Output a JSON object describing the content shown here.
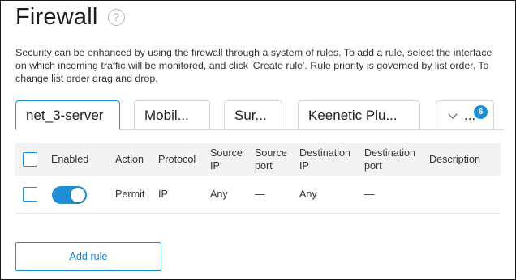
{
  "page": {
    "title": "Firewall",
    "help_icon": "?",
    "description": "Security can be enhanced by using the firewall through a system of rules. To add a rule, select the interface on which incoming traffic will be monitored, and click 'Create rule'. Rule priority is governed by list order. To change list order drag and drop."
  },
  "tabs": {
    "items": [
      {
        "label": "net_3-server",
        "active": true
      },
      {
        "label": "Mobil...",
        "active": false
      },
      {
        "label": "Sur...",
        "active": false
      },
      {
        "label": "Keenetic Plu...",
        "active": false
      }
    ],
    "more_label": "...",
    "more_badge": "6"
  },
  "table": {
    "headers": {
      "enabled": "Enabled",
      "action": "Action",
      "protocol": "Protocol",
      "source_ip": "Source IP",
      "source_port": "Source port",
      "destination_ip": "Destination IP",
      "destination_port": "Destination port",
      "description": "Description"
    },
    "rows": [
      {
        "enabled": true,
        "action": "Permit",
        "protocol": "IP",
        "source_ip": "Any",
        "source_port": "—",
        "destination_ip": "Any",
        "destination_port": "—",
        "description": ""
      }
    ]
  },
  "buttons": {
    "add_rule": "Add rule"
  },
  "colors": {
    "accent": "#1e8fd6",
    "header_bg": "#f3f3f3"
  }
}
